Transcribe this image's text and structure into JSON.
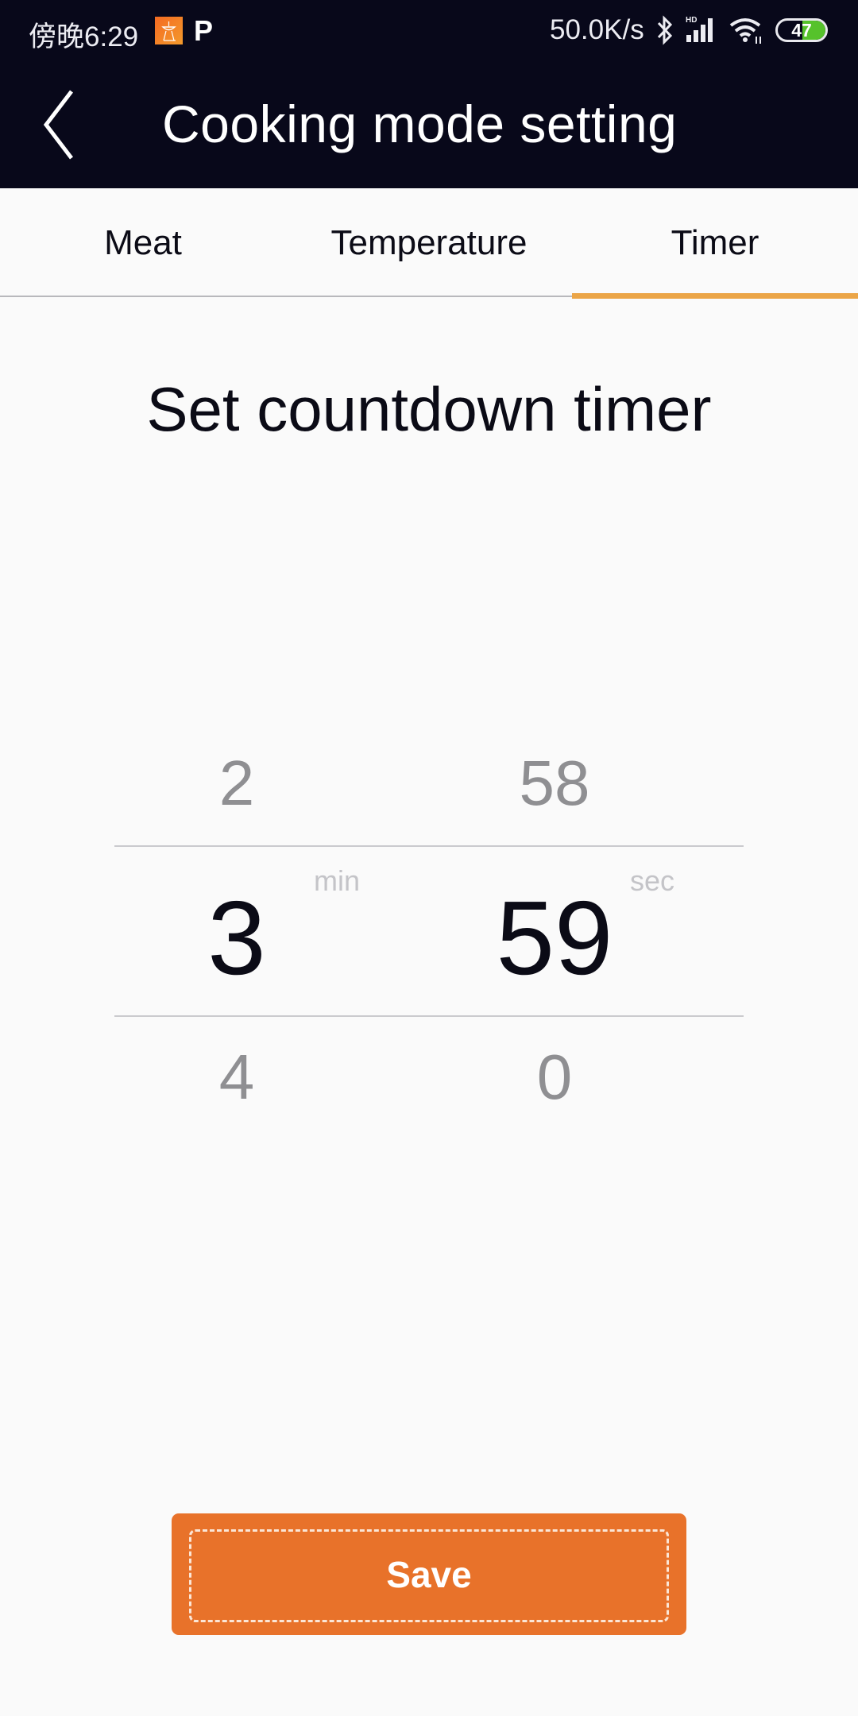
{
  "status_bar": {
    "time": "傍晚6:29",
    "app_icon": "grill-icon",
    "p_icon": "P",
    "network_speed": "50.0K/s",
    "bluetooth_icon": "bluetooth-icon",
    "signal_label": "HD",
    "wifi_icon": "wifi-icon",
    "battery_level": "47"
  },
  "header": {
    "back_icon": "chevron-left-icon",
    "title": "Cooking mode setting"
  },
  "tabs": [
    {
      "label": "Meat",
      "active": false
    },
    {
      "label": "Temperature",
      "active": false
    },
    {
      "label": "Timer",
      "active": true
    }
  ],
  "main": {
    "heading": "Set countdown timer",
    "picker": {
      "minutes": {
        "prev": "2",
        "current": "3",
        "next": "4",
        "unit": "min"
      },
      "seconds": {
        "prev": "58",
        "current": "59",
        "next": "0",
        "unit": "sec"
      }
    },
    "save_label": "Save"
  },
  "colors": {
    "header_bg": "#08081a",
    "accent_tab": "#eba547",
    "save_button": "#e8722a",
    "battery_fill": "#56c22b"
  }
}
